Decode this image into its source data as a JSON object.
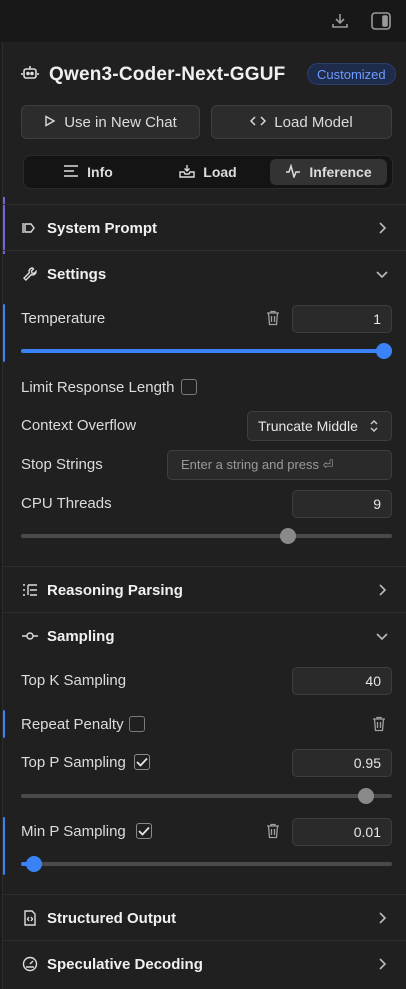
{
  "toolbar": {
    "download_icon": "download-icon",
    "panel_icon": "sidebar-toggle-icon"
  },
  "model": {
    "name": "Qwen3-Coder-Next-GGUF",
    "badge": "Customized",
    "icon": "robot-icon"
  },
  "actions": {
    "use_chat": "Use in New Chat",
    "load_model": "Load Model"
  },
  "tabs": [
    {
      "label": "Info",
      "icon": "list-icon",
      "active": false
    },
    {
      "label": "Load",
      "icon": "tray-download-icon",
      "active": false
    },
    {
      "label": "Inference",
      "icon": "waveform-icon",
      "active": true
    }
  ],
  "sections": {
    "system_prompt": {
      "title": "System Prompt",
      "expanded": false
    },
    "settings": {
      "title": "Settings",
      "expanded": true
    },
    "reasoning": {
      "title": "Reasoning Parsing",
      "expanded": false
    },
    "sampling": {
      "title": "Sampling",
      "expanded": true
    },
    "structured": {
      "title": "Structured Output",
      "expanded": false
    },
    "speculative": {
      "title": "Speculative Decoding",
      "expanded": false
    }
  },
  "settings": {
    "temperature": {
      "label": "Temperature",
      "value": "1",
      "slider_fraction": 1.0
    },
    "limit_length": {
      "label": "Limit Response Length",
      "checked": false
    },
    "context_overflow": {
      "label": "Context Overflow",
      "value": "Truncate Middle"
    },
    "stop_strings": {
      "label": "Stop Strings",
      "placeholder": "Enter a string and press ⏎"
    },
    "cpu_threads": {
      "label": "CPU Threads",
      "value": "9",
      "slider_fraction": 0.72
    }
  },
  "sampling": {
    "top_k": {
      "label": "Top K Sampling",
      "value": "40"
    },
    "repeat_penalty": {
      "label": "Repeat Penalty",
      "checked": false
    },
    "top_p": {
      "label": "Top P Sampling",
      "checked": true,
      "value": "0.95",
      "slider_fraction": 0.93
    },
    "min_p": {
      "label": "Min P Sampling",
      "checked": true,
      "value": "0.01",
      "slider_fraction": 0.035
    }
  },
  "colors": {
    "accent": "#3b82f6",
    "badge_text": "#6f9cff",
    "background": "#202020"
  }
}
